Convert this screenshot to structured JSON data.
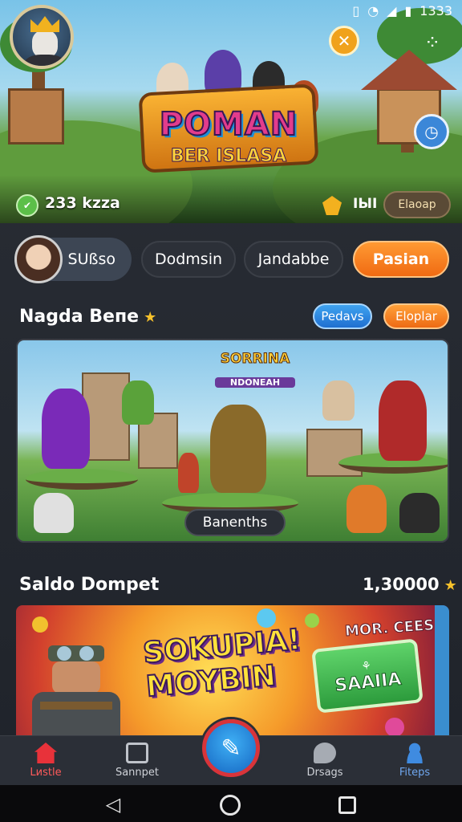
{
  "status_bar": {
    "time": "1333"
  },
  "hero": {
    "logo_title": "POMAN",
    "logo_subtitle": "BER ISLASA",
    "coins": "233 kzza",
    "ratio_label": "IЫI",
    "map_button": "Elaoap"
  },
  "tabs": [
    {
      "label": "SUßso"
    },
    {
      "label": "Dodmsin"
    },
    {
      "label": "Jandabbe"
    },
    {
      "label": "Pasian"
    }
  ],
  "section1": {
    "title": "Nagda Beпe",
    "pill_blue": "Pedavs",
    "pill_orange": "Eloplar",
    "card_logo_line1": "SORRINA",
    "card_logo_line2": "NDONEAH",
    "card_button": "Banenths"
  },
  "section2": {
    "title": "Saldo Dompet",
    "balance": "1,30000",
    "banner_text": "SOKUPIA! MOYBIN",
    "banner_promo": "MOR. CEES,",
    "banner_sign": "SAAIIA"
  },
  "bottom_nav": [
    {
      "label": "Lиstle",
      "icon": "home-icon"
    },
    {
      "label": "Sannpet",
      "icon": "wallet-icon"
    },
    {
      "label": "Drsags",
      "icon": "chat-icon"
    },
    {
      "label": "Fiteps",
      "icon": "profile-icon"
    }
  ],
  "colors": {
    "accent_orange": "#f06a12",
    "accent_blue": "#1f6fd0",
    "active_red": "#e8323a"
  }
}
